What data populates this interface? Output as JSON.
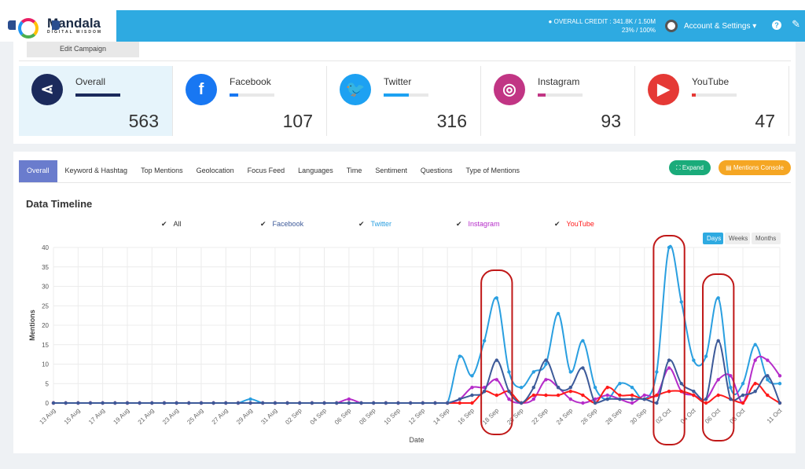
{
  "header": {
    "brand": "Mandala",
    "brand_sub": "DIGITAL WISDOM",
    "credit_line1": "OVERALL CREDIT : 341.8K / 1.50M",
    "credit_line2": "23% / 100%",
    "account_label": "Account & Settings ▾",
    "help_icon": "question-circle-icon",
    "brush_icon": "brush-icon"
  },
  "edit_campaign": "Edit Campaign",
  "cards": [
    {
      "name": "Overall",
      "value": "563",
      "color": "#1b2a5c",
      "icon": "share-icon",
      "glyph": "⋖",
      "fill_pct": 100
    },
    {
      "name": "Facebook",
      "value": "107",
      "color": "#1877f2",
      "icon": "facebook-icon",
      "glyph": "f",
      "fill_pct": 19
    },
    {
      "name": "Twitter",
      "value": "316",
      "color": "#1da1f2",
      "icon": "twitter-icon",
      "glyph": "🐦",
      "fill_pct": 56
    },
    {
      "name": "Instagram",
      "value": "93",
      "color": "#c13584",
      "icon": "instagram-icon",
      "glyph": "◎",
      "fill_pct": 17
    },
    {
      "name": "YouTube",
      "value": "47",
      "color": "#e53935",
      "icon": "youtube-icon",
      "glyph": "▶",
      "fill_pct": 8
    }
  ],
  "tabs": [
    "Overall",
    "Keyword & Hashtag",
    "Top Mentions",
    "Geolocation",
    "Focus Feed",
    "Languages",
    "Time",
    "Sentiment",
    "Questions",
    "Type of Mentions"
  ],
  "buttons": {
    "expand": "⛶ Expand",
    "console": "▤ Mentions Console",
    "expand_color": "#1aab7a",
    "console_color": "#f5a623"
  },
  "section_title": "Data Timeline",
  "legend": [
    {
      "label": "All",
      "color": "#333333"
    },
    {
      "label": "Facebook",
      "color": "#3d5a99"
    },
    {
      "label": "Twitter",
      "color": "#2a9fe0"
    },
    {
      "label": "Instagram",
      "color": "#b52cc9"
    },
    {
      "label": "YouTube",
      "color": "#ff1a1a"
    }
  ],
  "periods": [
    "Days",
    "Weeks",
    "Months"
  ],
  "chart_data": {
    "type": "line",
    "xlabel": "Date",
    "ylabel": "Mentions",
    "ylim": [
      0,
      40
    ],
    "yticks": [
      0,
      5,
      10,
      15,
      20,
      25,
      30,
      35,
      40
    ],
    "grid": true,
    "legend": "top",
    "x": [
      "13 Aug",
      "14 Aug",
      "15 Aug",
      "16 Aug",
      "17 Aug",
      "18 Aug",
      "19 Aug",
      "20 Aug",
      "21 Aug",
      "22 Aug",
      "23 Aug",
      "24 Aug",
      "25 Aug",
      "26 Aug",
      "27 Aug",
      "28 Aug",
      "29 Aug",
      "30 Aug",
      "31 Aug",
      "01 Sep",
      "02 Sep",
      "03 Sep",
      "04 Sep",
      "05 Sep",
      "06 Sep",
      "07 Sep",
      "08 Sep",
      "09 Sep",
      "10 Sep",
      "11 Sep",
      "12 Sep",
      "13 Sep",
      "14 Sep",
      "15 Sep",
      "16 Sep",
      "17 Sep",
      "18 Sep",
      "19 Sep",
      "20 Sep",
      "21 Sep",
      "22 Sep",
      "23 Sep",
      "24 Sep",
      "25 Sep",
      "26 Sep",
      "27 Sep",
      "28 Sep",
      "29 Sep",
      "30 Sep",
      "01 Oct",
      "02 Oct",
      "03 Oct",
      "04 Oct",
      "05 Oct",
      "06 Oct",
      "07 Oct",
      "08 Oct",
      "09 Oct",
      "10 Oct",
      "11 Oct"
    ],
    "xticks": [
      "13 Aug",
      "15 Aug",
      "17 Aug",
      "19 Aug",
      "21 Aug",
      "23 Aug",
      "25 Aug",
      "27 Aug",
      "29 Aug",
      "31 Aug",
      "02 Sep",
      "04 Sep",
      "06 Sep",
      "08 Sep",
      "10 Sep",
      "12 Sep",
      "14 Sep",
      "16 Sep",
      "18 Sep",
      "20 Sep",
      "22 Sep",
      "24 Sep",
      "26 Sep",
      "28 Sep",
      "30 Sep",
      "02 Oct",
      "04 Oct",
      "06 Oct",
      "08 Oct",
      "11 Oct"
    ],
    "series": [
      {
        "name": "Twitter",
        "color": "#2a9fe0",
        "values": [
          0,
          0,
          0,
          0,
          0,
          0,
          0,
          0,
          0,
          0,
          0,
          0,
          0,
          0,
          0,
          0,
          1,
          0,
          0,
          0,
          0,
          0,
          0,
          0,
          0,
          0,
          0,
          0,
          0,
          0,
          0,
          0,
          0,
          12,
          7,
          16,
          27,
          8,
          4,
          8,
          10,
          23,
          8,
          16,
          4,
          1,
          5,
          4,
          1,
          8,
          40,
          26,
          11,
          12,
          27,
          4,
          5,
          15,
          6,
          5
        ]
      },
      {
        "name": "Instagram",
        "color": "#b52cc9",
        "values": [
          0,
          0,
          0,
          0,
          0,
          0,
          0,
          0,
          0,
          0,
          0,
          0,
          0,
          0,
          0,
          0,
          0,
          0,
          0,
          0,
          0,
          0,
          0,
          0,
          1,
          0,
          0,
          0,
          0,
          0,
          0,
          0,
          0,
          1,
          4,
          4,
          6,
          1,
          0,
          1,
          6,
          4,
          1,
          0,
          1,
          2,
          1,
          0,
          2,
          2,
          9,
          3,
          2,
          1,
          6,
          7,
          0,
          11,
          11,
          7
        ]
      },
      {
        "name": "YouTube",
        "color": "#ff1a1a",
        "values": [
          0,
          0,
          0,
          0,
          0,
          0,
          0,
          0,
          0,
          0,
          0,
          0,
          0,
          0,
          0,
          0,
          0,
          0,
          0,
          0,
          0,
          0,
          0,
          0,
          0,
          0,
          0,
          0,
          0,
          0,
          0,
          0,
          0,
          0,
          0,
          3,
          2,
          3,
          0,
          2,
          2,
          2,
          3,
          2,
          0,
          4,
          2,
          2,
          1,
          2,
          3,
          3,
          2,
          0,
          2,
          1,
          0,
          5,
          2,
          0
        ]
      },
      {
        "name": "Facebook",
        "color": "#3d5a99",
        "values": [
          0,
          0,
          0,
          0,
          0,
          0,
          0,
          0,
          0,
          0,
          0,
          0,
          0,
          0,
          0,
          0,
          0,
          0,
          0,
          0,
          0,
          0,
          0,
          0,
          0,
          0,
          0,
          0,
          0,
          0,
          0,
          0,
          0,
          1,
          2,
          3,
          11,
          3,
          0,
          4,
          11,
          4,
          4,
          9,
          0,
          1,
          1,
          1,
          1,
          0,
          11,
          5,
          3,
          1,
          16,
          1,
          2,
          3,
          7,
          0
        ]
      }
    ],
    "highlights": [
      [
        "17 Sep",
        "19 Sep"
      ],
      [
        "01 Oct",
        "03 Oct"
      ],
      [
        "05 Oct",
        "07 Oct"
      ]
    ]
  }
}
